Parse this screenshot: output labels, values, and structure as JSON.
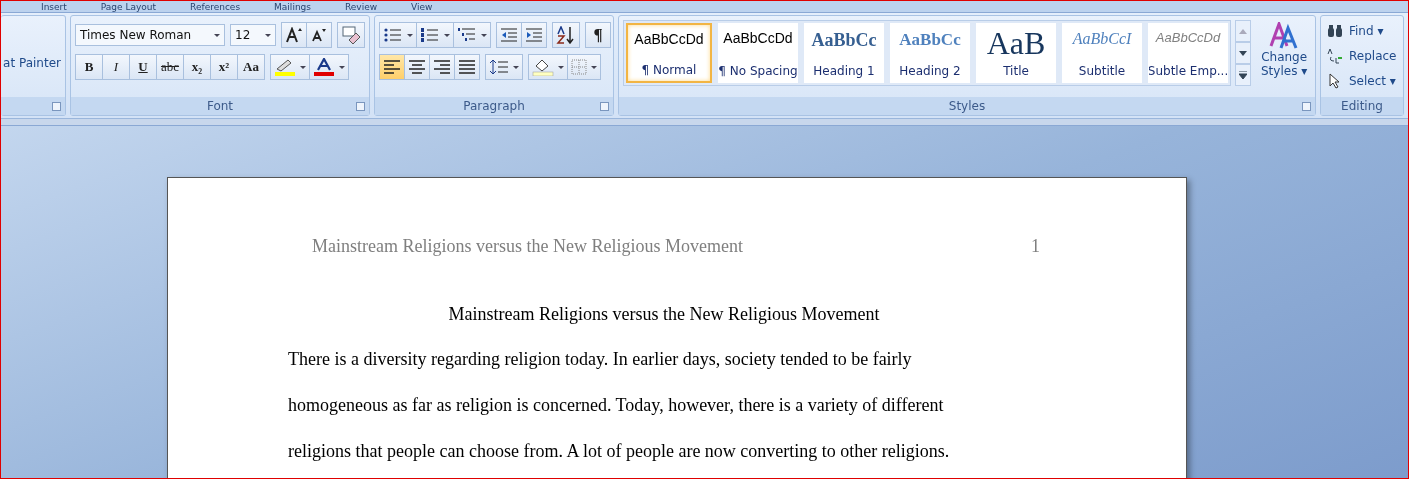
{
  "tabs": [
    {
      "label": "Insert"
    },
    {
      "label": "Page Layout"
    },
    {
      "label": "References"
    },
    {
      "label": "Mailings"
    },
    {
      "label": "Review"
    },
    {
      "label": "View"
    }
  ],
  "clipboard": {
    "format_painter": "at Painter"
  },
  "font": {
    "name": "Times New Roman",
    "size": "12",
    "group_label": "Font",
    "format_buttons": [
      {
        "text": "B",
        "kind": "bold"
      },
      {
        "text": "I",
        "kind": "italic"
      },
      {
        "text": "U",
        "kind": "underline"
      },
      {
        "text": "abc",
        "kind": "strike"
      },
      {
        "text": "x₂",
        "kind": "plain"
      },
      {
        "text": "x²",
        "kind": "plain"
      },
      {
        "text": "Aa",
        "kind": "plain"
      }
    ]
  },
  "paragraph": {
    "group_label": "Paragraph",
    "pilcrow": "¶",
    "alignments": [
      {
        "selected": true
      },
      {
        "selected": false
      },
      {
        "selected": false
      },
      {
        "selected": false
      }
    ]
  },
  "styles": {
    "group_label": "Styles",
    "items": [
      {
        "sample": "AaBbCcDd",
        "label": "¶ Normal",
        "kind": "normal",
        "selected": true
      },
      {
        "sample": "AaBbCcDd",
        "label": "¶ No Spacing",
        "kind": "normal",
        "selected": false
      },
      {
        "sample": "AaBbCc",
        "label": "Heading 1",
        "kind": "heading1",
        "selected": false
      },
      {
        "sample": "AaBbCc",
        "label": "Heading 2",
        "kind": "heading2",
        "selected": false
      },
      {
        "sample": "AaB",
        "label": "Title",
        "kind": "title",
        "selected": false
      },
      {
        "sample": "AaBbCcI",
        "label": "Subtitle",
        "kind": "subtitle",
        "selected": false
      },
      {
        "sample": "AaBbCcDd",
        "label": "Subtle Emp...",
        "kind": "subtle",
        "selected": false
      }
    ],
    "change_styles": [
      "Change",
      "Styles ▾"
    ]
  },
  "editing": {
    "group_label": "Editing",
    "find": "Find ▾",
    "replace": "Replace",
    "select": "Select ▾"
  },
  "document": {
    "header": "Mainstream Religions versus the New Religious Movement",
    "page_number": "1",
    "title": "Mainstream Religions versus the New Religious Movement",
    "lines": [
      "There is a diversity regarding religion today. In earlier days, society tended to be fairly",
      "homogeneous as far as religion is concerned. Today, however, there is a variety of different",
      "religions that people can choose from. A lot of people are now converting to other religions."
    ]
  }
}
